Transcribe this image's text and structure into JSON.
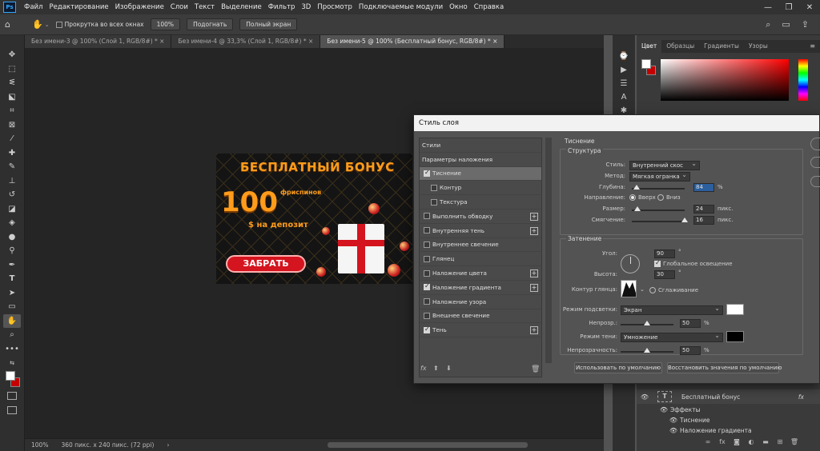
{
  "menu": {
    "logo": "Ps",
    "items": [
      "Файл",
      "Редактирование",
      "Изображение",
      "Слои",
      "Текст",
      "Выделение",
      "Фильтр",
      "3D",
      "Просмотр",
      "Подключаемые модули",
      "Окно",
      "Справка"
    ]
  },
  "options": {
    "scroll_all": "Прокрутка во всех окнах",
    "zoom": "100%",
    "fit": "Подогнать",
    "fullscreen": "Полный экран"
  },
  "tabs": [
    "Без имени-3 @ 100% (Слой 1, RGB/8#) * ×",
    "Без имени-4 @ 33,3% (Слой 1, RGB/8#) * ×",
    "Без имени-5 @ 100% (Бесплатный бонус, RGB/8#) * ×"
  ],
  "artwork": {
    "title": "БЕСПЛАТНЫЙ БОНУС",
    "number": "100",
    "spins": "фриспинов",
    "deposit": "$ на депозит",
    "button": "ЗАБРАТЬ"
  },
  "status": {
    "zoom": "100%",
    "size": "360 пикс. x 240 пикс. (72 ppi)"
  },
  "color_panel": {
    "tabs": [
      "Цвет",
      "Образцы",
      "Градиенты",
      "Узоры"
    ],
    "foreground": "#ffffff",
    "background": "#c40000"
  },
  "layers": {
    "layer_name": "Бесплатный бонус",
    "fx": "fx",
    "effects_label": "Эффекты",
    "effect_1": "Тиснение",
    "effect_2": "Наложение градиента"
  },
  "dialog": {
    "title": "Стиль слоя",
    "list": [
      {
        "label": "Стили",
        "check": null,
        "plus": false,
        "selected": false,
        "sub": false
      },
      {
        "label": "Параметры наложения",
        "check": null,
        "plus": false,
        "selected": false,
        "sub": false
      },
      {
        "label": "Тиснение",
        "check": true,
        "plus": false,
        "selected": true,
        "sub": false
      },
      {
        "label": "Контур",
        "check": false,
        "plus": false,
        "selected": false,
        "sub": true
      },
      {
        "label": "Текстура",
        "check": false,
        "plus": false,
        "selected": false,
        "sub": true
      },
      {
        "label": "Выполнить обводку",
        "check": false,
        "plus": true,
        "selected": false,
        "sub": false
      },
      {
        "label": "Внутренняя тень",
        "check": false,
        "plus": true,
        "selected": false,
        "sub": false
      },
      {
        "label": "Внутреннее свечение",
        "check": false,
        "plus": false,
        "selected": false,
        "sub": false
      },
      {
        "label": "Глянец",
        "check": false,
        "plus": false,
        "selected": false,
        "sub": false
      },
      {
        "label": "Наложение цвета",
        "check": false,
        "plus": true,
        "selected": false,
        "sub": false
      },
      {
        "label": "Наложение градиента",
        "check": true,
        "plus": true,
        "selected": false,
        "sub": false
      },
      {
        "label": "Наложение узора",
        "check": false,
        "plus": false,
        "selected": false,
        "sub": false
      },
      {
        "label": "Внешнее свечение",
        "check": false,
        "plus": false,
        "selected": false,
        "sub": false
      },
      {
        "label": "Тень",
        "check": true,
        "plus": true,
        "selected": false,
        "sub": false
      }
    ],
    "section": "Тиснение",
    "structure": {
      "title": "Структура",
      "style_label": "Стиль:",
      "style_value": "Внутренний скос",
      "method_label": "Метод:",
      "method_value": "Мягкая огранка",
      "depth_label": "Глубина:",
      "depth_value": "84",
      "depth_unit": "%",
      "depth_fraction": 0.084,
      "direction_label": "Направление:",
      "dir_up": "Вверх",
      "dir_down": "Вниз",
      "size_label": "Размер:",
      "size_value": "24",
      "size_unit": "пикс.",
      "size_fraction": 0.1,
      "soften_label": "Смягчение:",
      "soften_value": "16",
      "soften_unit": "пикс.",
      "soften_fraction": 1.0
    },
    "shading": {
      "title": "Затенение",
      "angle_label": "Угол:",
      "angle_value": "90",
      "angle_unit": "°",
      "global_light": "Глобальное освещение",
      "altitude_label": "Высота:",
      "altitude_value": "30",
      "altitude_unit": "°",
      "gloss_label": "Контур глянца:",
      "antialias": "Сглаживание",
      "highlight_label": "Режим подсветки:",
      "highlight_value": "Экран",
      "highlight_color": "#ffffff",
      "opacity1_label": "Непрозр.:",
      "opacity1_value": "50",
      "opacity1_unit": "%",
      "opacity1_fraction": 0.5,
      "shadow_label": "Режим тени:",
      "shadow_value": "Умножение",
      "shadow_color": "#000000",
      "opacity2_label": "Непрозрачность:",
      "opacity2_value": "50",
      "opacity2_unit": "%",
      "opacity2_fraction": 0.5
    },
    "btn_default": "Использовать по умолчанию",
    "btn_reset": "Восстановить значения по умолчанию",
    "fx_label": "fx"
  }
}
